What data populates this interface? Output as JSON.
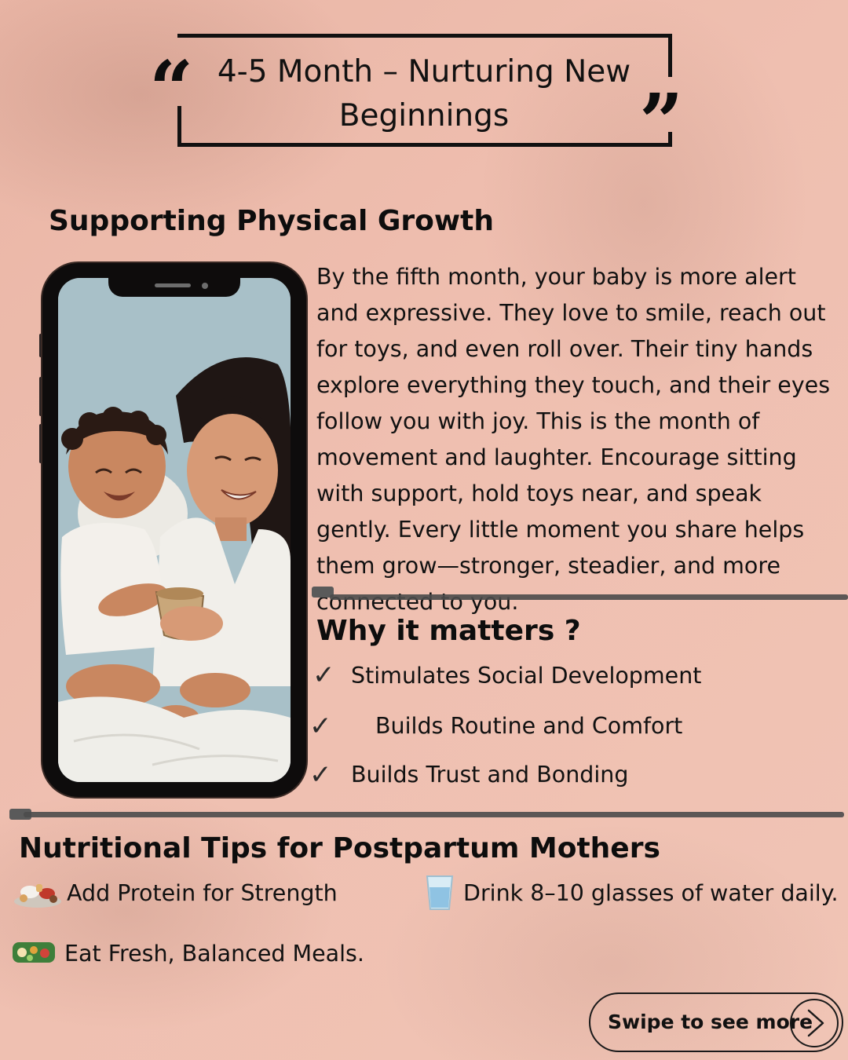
{
  "header": {
    "title": "4-5 Month – Nurturing New Beginnings",
    "quote_open_icon": "opening-quote-icon",
    "quote_close_icon": "closing-quote-icon"
  },
  "physical": {
    "heading": "Supporting Physical Growth",
    "body": "By the fifth month, your baby is more alert and expressive. They love to smile, reach out for toys, and even roll over. Their tiny hands explore everything they touch, and their eyes follow you with joy. This is the month of movement and laughter. Encourage sitting with support, hold toys near, and speak gently. Every little moment you share helps them grow—stronger, steadier, and more connected to you.",
    "image": "phone-mockup-mother-baby-illustration"
  },
  "why": {
    "heading": "Why it matters ?",
    "check_glyph": "✓",
    "items": [
      "Stimulates Social Development",
      "Builds Routine and Comfort",
      "Builds Trust and Bonding"
    ]
  },
  "nutrition": {
    "heading": "Nutritional Tips for Postpartum Mothers",
    "tips": [
      {
        "icon": "protein-food-icon",
        "text": "Add Protein for Strength"
      },
      {
        "icon": "water-glass-icon",
        "text": "Drink 8–10 glasses of water daily."
      },
      {
        "icon": "balanced-meal-icon",
        "text": "Eat Fresh, Balanced Meals."
      }
    ]
  },
  "footer": {
    "swipe_label": "Swipe to see more",
    "swipe_icon": "chevron-right-icon"
  },
  "colors": {
    "background": "#efbfb0",
    "text": "#111111",
    "divider": "#4b4b4b"
  }
}
